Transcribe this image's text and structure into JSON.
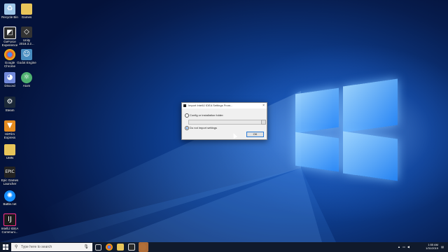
{
  "desktop": {
    "icons": [
      {
        "label": "Recycle Bin",
        "icon": "recycle-bin-icon",
        "color": "#9ec6e8"
      },
      {
        "label": "Games",
        "icon": "folder-icon",
        "color": "#e8c55a"
      },
      {
        "label": "GeForce\nExperience",
        "icon": "geforce-icon",
        "color": "#2b2b2b"
      },
      {
        "label": "Unity\n2018.3.2...",
        "icon": "unity-icon",
        "color": "#333333"
      },
      {
        "label": "Google\nChrome",
        "icon": "chrome-icon",
        "color": "#e04a3b"
      },
      {
        "label": "Godot Engine",
        "icon": "godot-icon",
        "color": "#478cbf"
      },
      {
        "label": "Discord",
        "icon": "discord-icon",
        "color": "#7289da"
      },
      {
        "label": "Atom",
        "icon": "atom-icon",
        "color": "#4fb070"
      },
      {
        "label": "Steam",
        "icon": "steam-icon",
        "color": "#1b2838"
      },
      {
        "label": "HitFilm\nExpress",
        "icon": "hitfilm-icon",
        "color": "#e58a1f"
      },
      {
        "label": "UMN",
        "icon": "folder-icon",
        "color": "#e8c55a"
      },
      {
        "label": "Epic Games\nLauncher",
        "icon": "epic-games-icon",
        "color": "#222222"
      },
      {
        "label": "Battle.net",
        "icon": "battlenet-icon",
        "color": "#148eff"
      },
      {
        "label": "IntelliJ IDEA\nCommuni...",
        "icon": "intellij-icon",
        "color": "#1a1a1a"
      }
    ]
  },
  "dialog": {
    "title": "Import IntelliJ IDEA Settings From...",
    "close_label": "×",
    "option_config": "Config or installation folder:",
    "option_none": "Do not import settings",
    "path_value": "",
    "browse_label": "…",
    "ok_label": "OK"
  },
  "taskbar": {
    "search_placeholder": "Type here to search",
    "time": "1:55 AM",
    "date": "1/31/2019",
    "apps": [
      "task-view-icon",
      "chrome-icon",
      "file-explorer-icon",
      "store-icon",
      "obs-icon",
      "intellij-icon"
    ]
  }
}
